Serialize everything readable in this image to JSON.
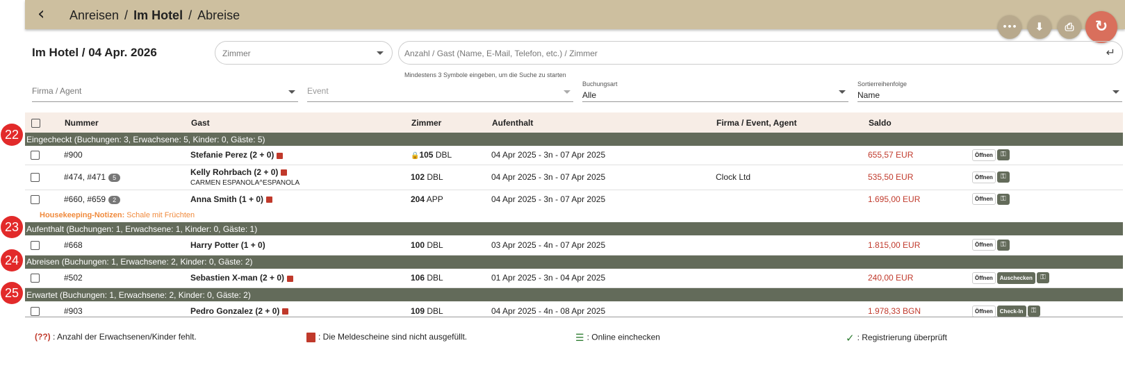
{
  "header": {
    "breadcrumbs": [
      "Anreisen",
      "Im Hotel",
      "Abreise"
    ],
    "separator": "/",
    "back_icon": "chevron-left-icon"
  },
  "toolbar": {
    "more": "•••",
    "download": "⬇",
    "print": "⎙",
    "refresh": "↻"
  },
  "page": {
    "title": "Im Hotel / 04 Apr. 2026"
  },
  "filters": {
    "zimmer_placeholder": "Zimmer",
    "search_placeholder": "Anzahl / Gast (Name, E-Mail, Telefon, etc.) / Zimmer",
    "search_hint": "Mindestens 3 Symbole eingeben, um die Suche zu starten",
    "firma_placeholder": "Firma / Agent",
    "event_placeholder": "Event",
    "buchungsart_label": "Buchungsart",
    "buchungsart_value": "Alle",
    "sort_label": "Sortierreihenfolge",
    "sort_value": "Name"
  },
  "table": {
    "headers": [
      "Nummer",
      "Gast",
      "Zimmer",
      "Aufenthalt",
      "Firma / Event, Agent",
      "Saldo"
    ],
    "groups": [
      {
        "marker": "22",
        "title": "Eingecheckt (Buchungen: 3, Erwachsene: 5, Kinder: 0, Gäste: 5)"
      },
      {
        "marker": "23",
        "title": "Aufenthalt (Buchungen: 1, Erwachsene: 1, Kinder: 0, Gäste: 1)"
      },
      {
        "marker": "24",
        "title": "Abreisen (Buchungen: 1, Erwachsene: 2, Kinder: 0, Gäste: 2)"
      },
      {
        "marker": "25",
        "title": "Erwartet (Buchungen: 1, Erwachsene: 2, Kinder: 0, Gäste: 2)"
      }
    ],
    "rows": [
      {
        "nummer": "#900",
        "gast": "Stefanie Perez (2 + 0)",
        "zimmer_nr": "105",
        "zimmer_typ": "DBL",
        "aufenthalt": "04 Apr 2025 - 3n - 07 Apr 2025",
        "firma": "",
        "saldo": "655,57 EUR",
        "open": "Öffnen"
      },
      {
        "nummer": "#474, #471",
        "badge": "5",
        "gast": "Kelly Rohrbach (2 + 0)",
        "gast_sub": "CARMEN ESPANOLA^ESPANOLA",
        "zimmer_nr": "102",
        "zimmer_typ": "DBL",
        "aufenthalt": "04 Apr 2025 - 3n - 07 Apr 2025",
        "firma": "Clock Ltd",
        "saldo": "535,50 EUR",
        "open": "Öffnen"
      },
      {
        "nummer": "#660, #659",
        "badge": "2",
        "gast": "Anna Smith (1 + 0)",
        "zimmer_nr": "204",
        "zimmer_typ": "APP",
        "aufenthalt": "04 Apr 2025 - 3n - 07 Apr 2025",
        "firma": "",
        "saldo": "1.695,00 EUR",
        "open": "Öffnen"
      },
      {
        "nummer": "#668",
        "gast": "Harry Potter (1 + 0)",
        "zimmer_nr": "100",
        "zimmer_typ": "DBL",
        "aufenthalt": "03 Apr 2025 - 4n - 07 Apr 2025",
        "firma": "",
        "saldo": "1.815,00 EUR",
        "open": "Öffnen"
      },
      {
        "nummer": "#502",
        "gast": "Sebastien X-man (2 + 0)",
        "zimmer_nr": "106",
        "zimmer_typ": "DBL",
        "aufenthalt": "01 Apr 2025 - 3n - 04 Apr 2025",
        "firma": "",
        "saldo": "240,00 EUR",
        "open": "Öffnen",
        "action": "Auschecken"
      },
      {
        "nummer": "#903",
        "gast": "Pedro Gonzalez (2 + 0)",
        "zimmer_nr": "109",
        "zimmer_typ": "DBL",
        "aufenthalt": "04 Apr 2025 - 4n - 08 Apr 2025",
        "firma": "",
        "saldo": "1.978,33 BGN",
        "open": "Öffnen",
        "action": "Check-In"
      }
    ],
    "housekeeping": {
      "label": "Housekeeping-Notizen:",
      "text": "Schale mit Früchten"
    }
  },
  "legend": {
    "missing_marker": "(??)",
    "missing_text": ": Anzahl der Erwachsenen/Kinder fehlt.",
    "doc_text": ": Die Meldescheine sind nicht ausgefüllt.",
    "online_text": ": Online einchecken",
    "verified_text": ": Registrierung überprüft"
  },
  "colors": {
    "accent": "#cdbf9f",
    "group": "#636b5a",
    "saldo": "#c0392b",
    "marker": "#e22a2a"
  }
}
